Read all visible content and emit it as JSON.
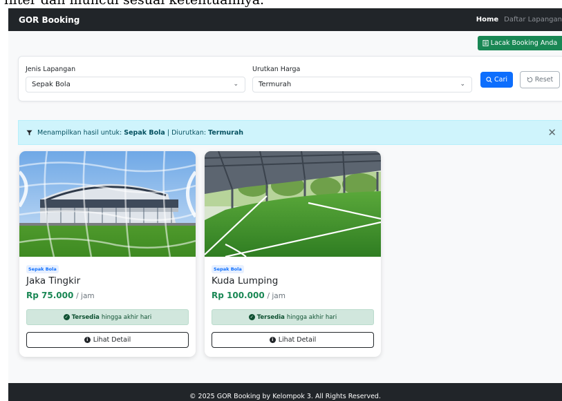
{
  "overlay": {
    "text": "filter dan muncul sesuai ketentuannya."
  },
  "navbar": {
    "brand": "GOR Booking",
    "links": [
      {
        "label": "Home"
      },
      {
        "label": "Daftar Lapangan"
      }
    ]
  },
  "track_button": {
    "label": "Lacak Booking Anda",
    "icon": "receipt-icon"
  },
  "filters": {
    "field_type": {
      "label": "Jenis Lapangan",
      "value": "Sepak Bola"
    },
    "sort_price": {
      "label": "Urutkan Harga",
      "value": "Termurah"
    },
    "search_button": {
      "label": "Cari",
      "icon": "search-icon"
    },
    "reset_button": {
      "label": "Reset",
      "icon": "reset-icon"
    }
  },
  "alert": {
    "prefix": "Menampilkan hasil untuk:",
    "type": "Sepak Bola",
    "separator": "| Diurutkan:",
    "sort": "Termurah",
    "icon": "filter-icon"
  },
  "cards": [
    {
      "category": "Sepak Bola",
      "name": "Jaka Tingkir",
      "price": "Rp 75.000",
      "unit": "/ jam",
      "availability_strong": "Tersedia",
      "availability_rest": "hingga akhir hari",
      "detail_label": "Lihat Detail"
    },
    {
      "category": "Sepak Bola",
      "name": "Kuda Lumping",
      "price": "Rp 100.000",
      "unit": "/ jam",
      "availability_strong": "Tersedia",
      "availability_rest": "hingga akhir hari",
      "detail_label": "Lihat Detail"
    }
  ],
  "footer": {
    "text": "© 2025 GOR Booking by Kelompok 3. All Rights Reserved."
  },
  "colors": {
    "navbar": "#212529",
    "success": "#198754",
    "primary": "#0d6efd",
    "info_alert": "#cff4fc",
    "availability": "#d1e7dd"
  }
}
